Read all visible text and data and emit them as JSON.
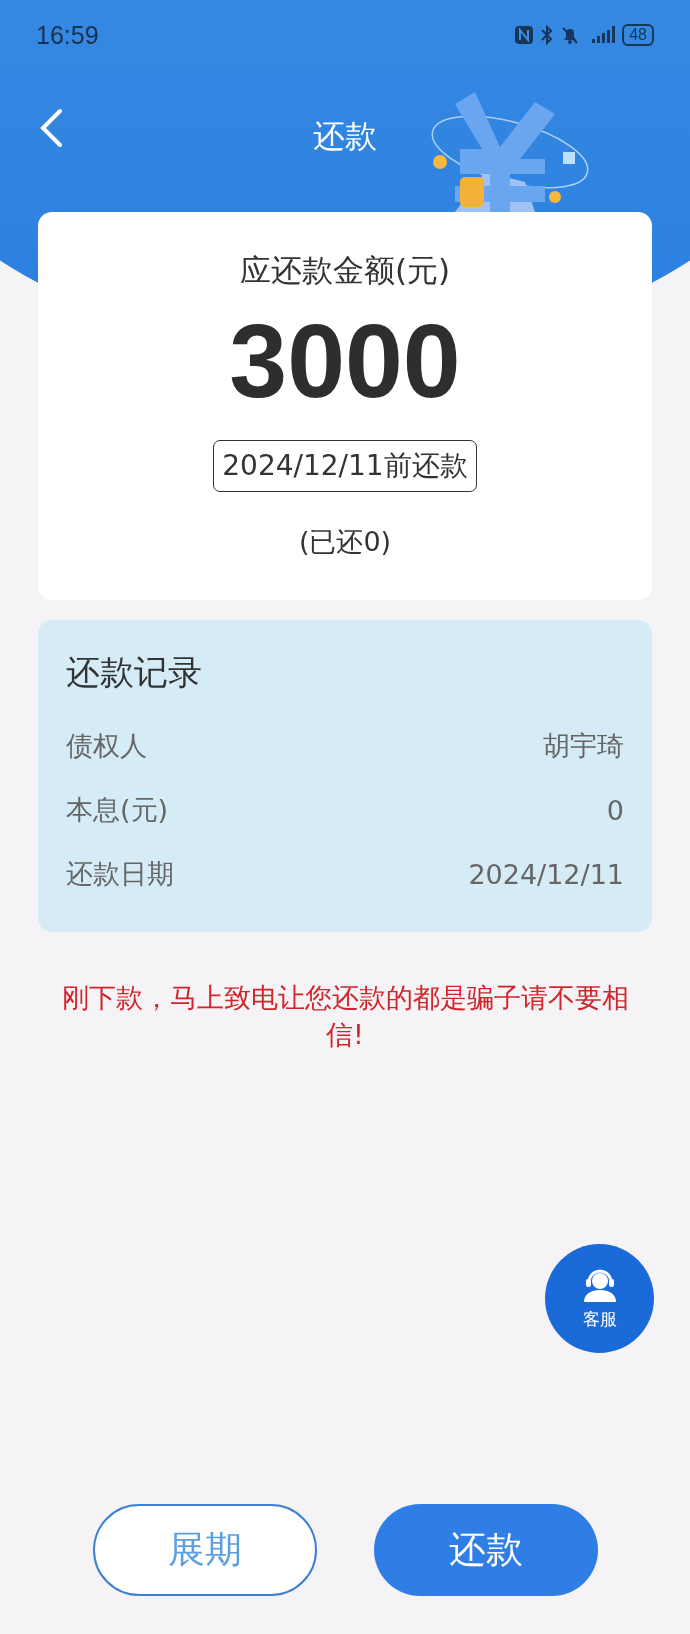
{
  "status_bar": {
    "time": "16:59",
    "battery": "48"
  },
  "header": {
    "title": "还款"
  },
  "amount_card": {
    "label": "应还款金额(元)",
    "amount": "3000",
    "due": "2024/12/11前还款",
    "paid": "(已还0)"
  },
  "record": {
    "title": "还款记录",
    "rows": [
      {
        "label": "债权人",
        "value": "胡宇琦"
      },
      {
        "label": "本息(元)",
        "value": "0"
      },
      {
        "label": "还款日期",
        "value": "2024/12/11"
      }
    ]
  },
  "warning": "刚下款，马上致电让您还款的都是骗子请不要相信!",
  "service_button": {
    "label": "客服"
  },
  "buttons": [
    {
      "label": "展期",
      "kind": "outline"
    },
    {
      "label": "还款",
      "kind": "filled"
    }
  ]
}
